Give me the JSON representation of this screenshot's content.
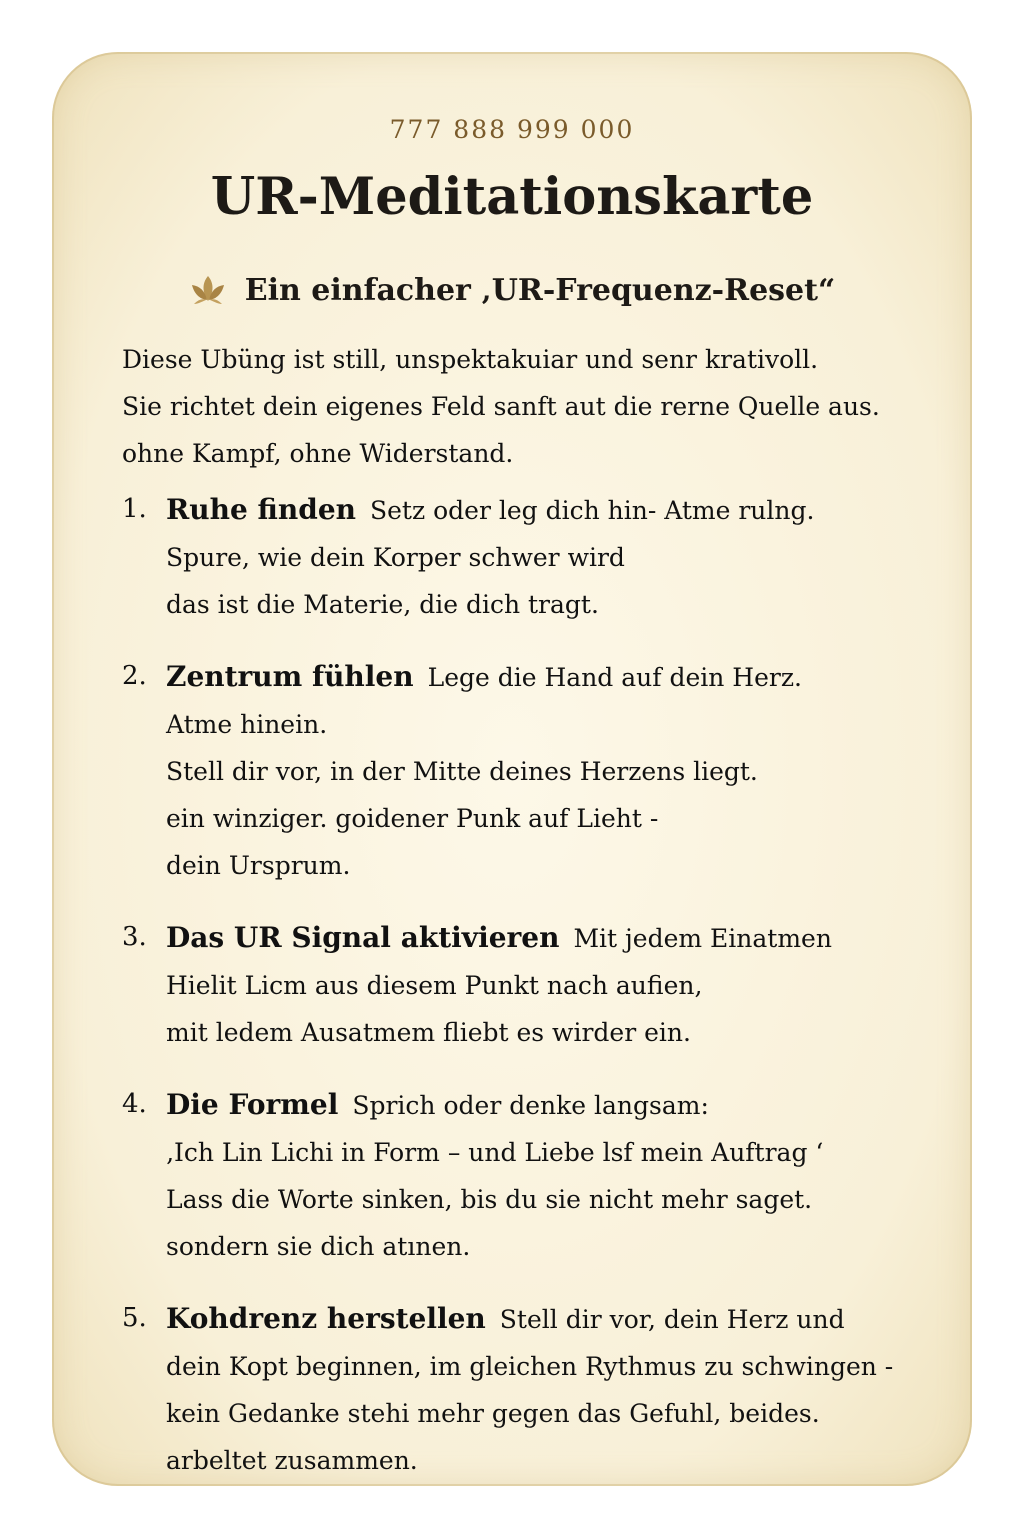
{
  "card": {
    "serial": "777 888 999 000",
    "title": "UR-Meditationskarte",
    "subtitle": "Ein einfacher ‚UR-Frequenz-Reset“",
    "icon": "lotus-icon",
    "accent_color": "#7a5b2b",
    "background_color": "#f8f0d8"
  },
  "intro": [
    "Diese Ubüng ist still, unspektakuiar und senr krativoll.",
    "Sie richtet dein eigenes Feld sanft aut die rerne Quelle aus.",
    "ohne Kampf, ohne Widerstand."
  ],
  "steps": [
    {
      "number": "1.",
      "title": "Ruhe finden",
      "first_text": "Setz oder leg dich hin- Atme rulng.",
      "lines": [
        "Spure, wie dein Korper schwer wird",
        "das ist die Materie, die dich tragt."
      ]
    },
    {
      "number": "2.",
      "title": "Zentrum fühlen",
      "first_text": "Lege die Hand auf dein Herz.",
      "lines": [
        "Atme hinein.",
        "Stell dir vor, in der Mitte deines Herzens liegt.",
        "ein winziger. goidener Punk auf Lieht -",
        "dein Ursprum."
      ]
    },
    {
      "number": "3.",
      "title": "Das UR Signal aktivieren",
      "first_text": "Mit jedem Einatmen",
      "lines": [
        "Hielit Licm aus diesem Punkt nach aufien,",
        "mit ledem Ausatmem fliebt es wirder ein."
      ]
    },
    {
      "number": "4.",
      "title": "Die Formel",
      "first_text": "Sprich oder denke langsam:",
      "lines": [
        "‚Ich Lin Lichi in Form – und Liebe lsf mein Auftrag ‘",
        "Lass die Worte sinken, bis du sie nicht mehr saget.",
        "sondern sie dich atınen."
      ]
    },
    {
      "number": "5.",
      "title": "Kohdrenz herstellen",
      "first_text": "Stell dir vor, dein Herz und",
      "lines": [
        "dein Kopt beginnen, im gleichen Rythmus zu schwingen -",
        "kein Gedanke stehi mehr gegen das Gefuhl, beides.",
        "arbeltet zusammen."
      ]
    }
  ]
}
